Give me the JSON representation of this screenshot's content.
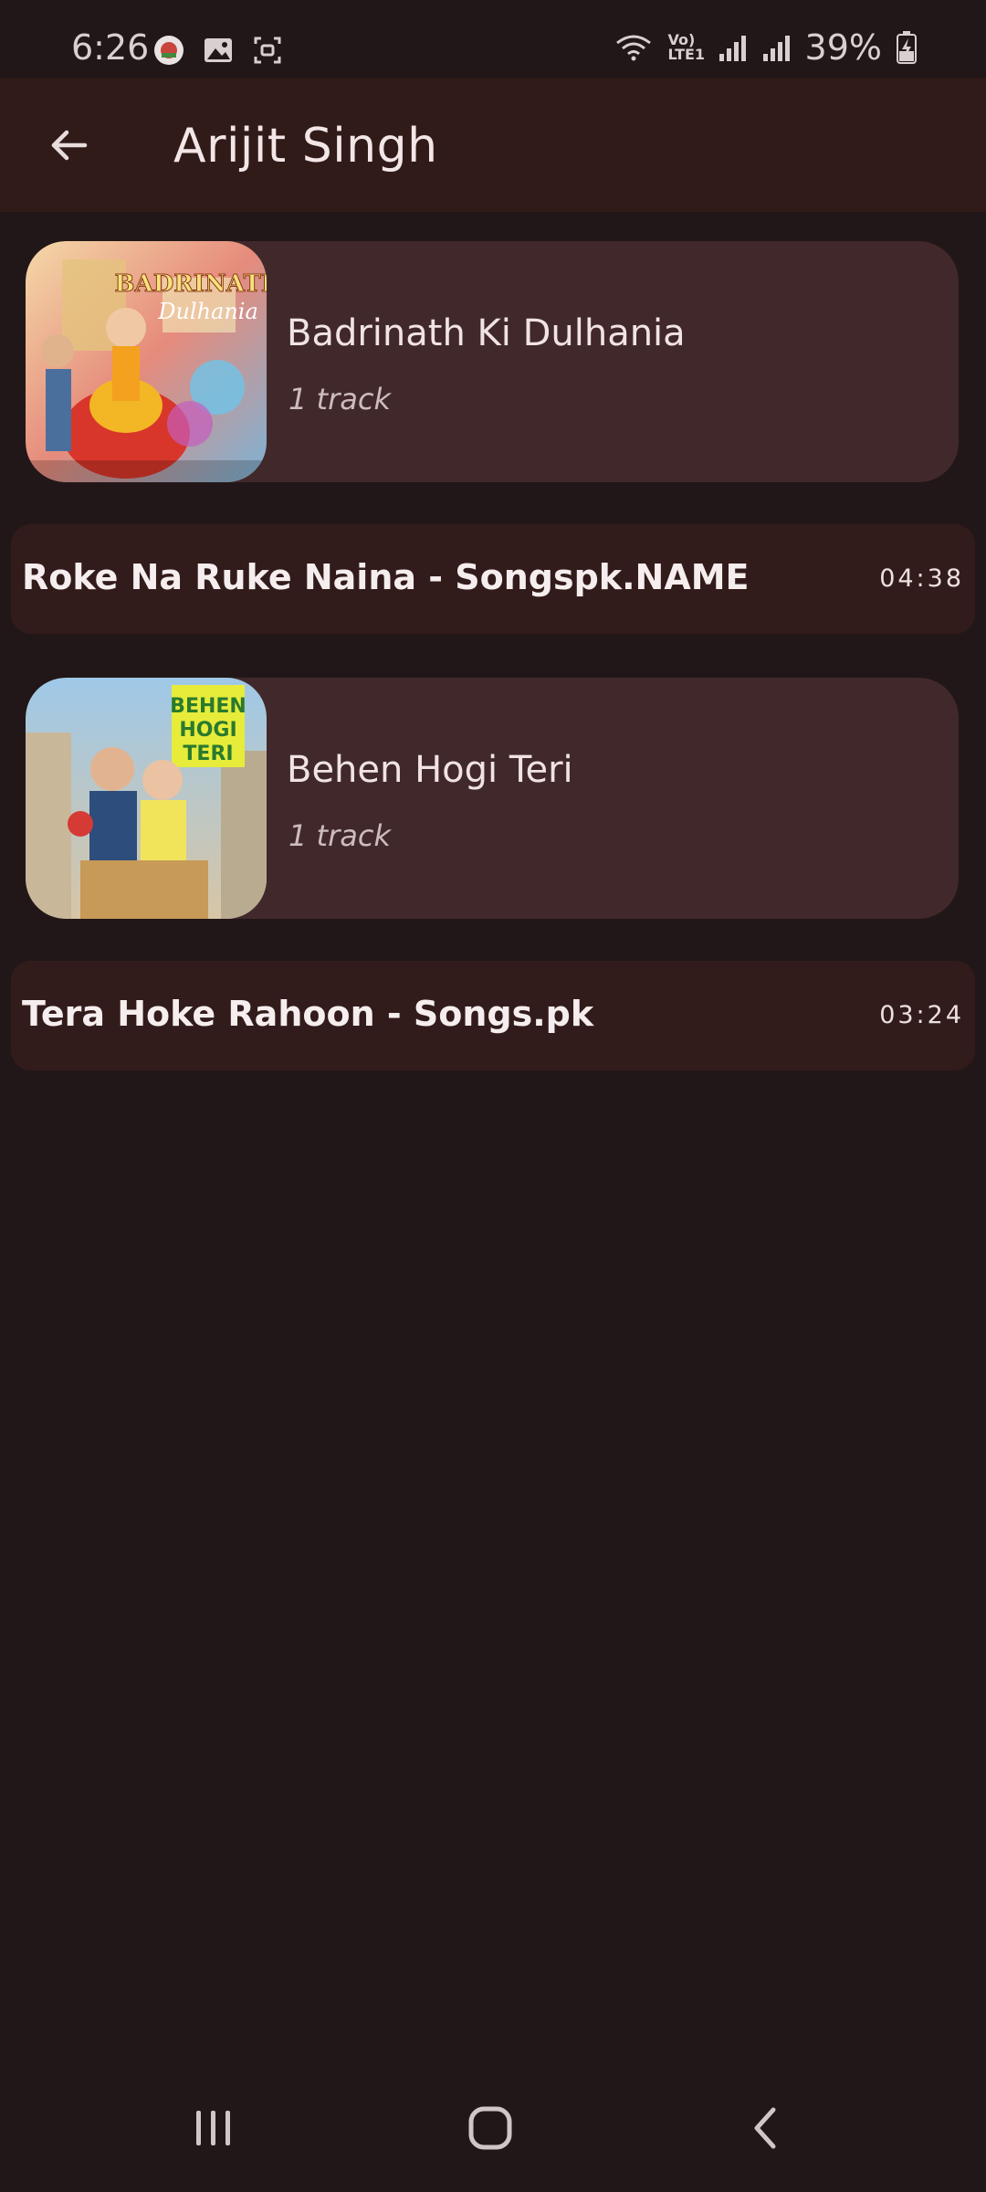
{
  "status_bar": {
    "time": "6:26",
    "network_label": "Vo) LTE1",
    "battery": "39%"
  },
  "app_bar": {
    "title": "Arijit Singh",
    "back_icon": "arrow-back-icon"
  },
  "items": [
    {
      "kind": "album",
      "name": "Badrinath Ki Dulhania",
      "count": "1 track",
      "art_text": "BADRINATH Dulhania"
    },
    {
      "kind": "track",
      "title": "Roke Na Ruke Naina - Songspk.NAME",
      "duration": "04:38"
    },
    {
      "kind": "album",
      "name": "Behen Hogi Teri",
      "count": "1 track",
      "art_text": "BEHEN HOGI TERI"
    },
    {
      "kind": "track",
      "title": "Tera Hoke Rahoon - Songs.pk",
      "duration": "03:24"
    }
  ],
  "nav_bar": {
    "recents_icon": "recents-icon",
    "home_icon": "home-icon",
    "back_icon": "nav-back-icon"
  },
  "colors": {
    "background": "#221718",
    "app_bar": "#311b19",
    "album_card": "#41292b",
    "track_row": "#321c1b"
  }
}
